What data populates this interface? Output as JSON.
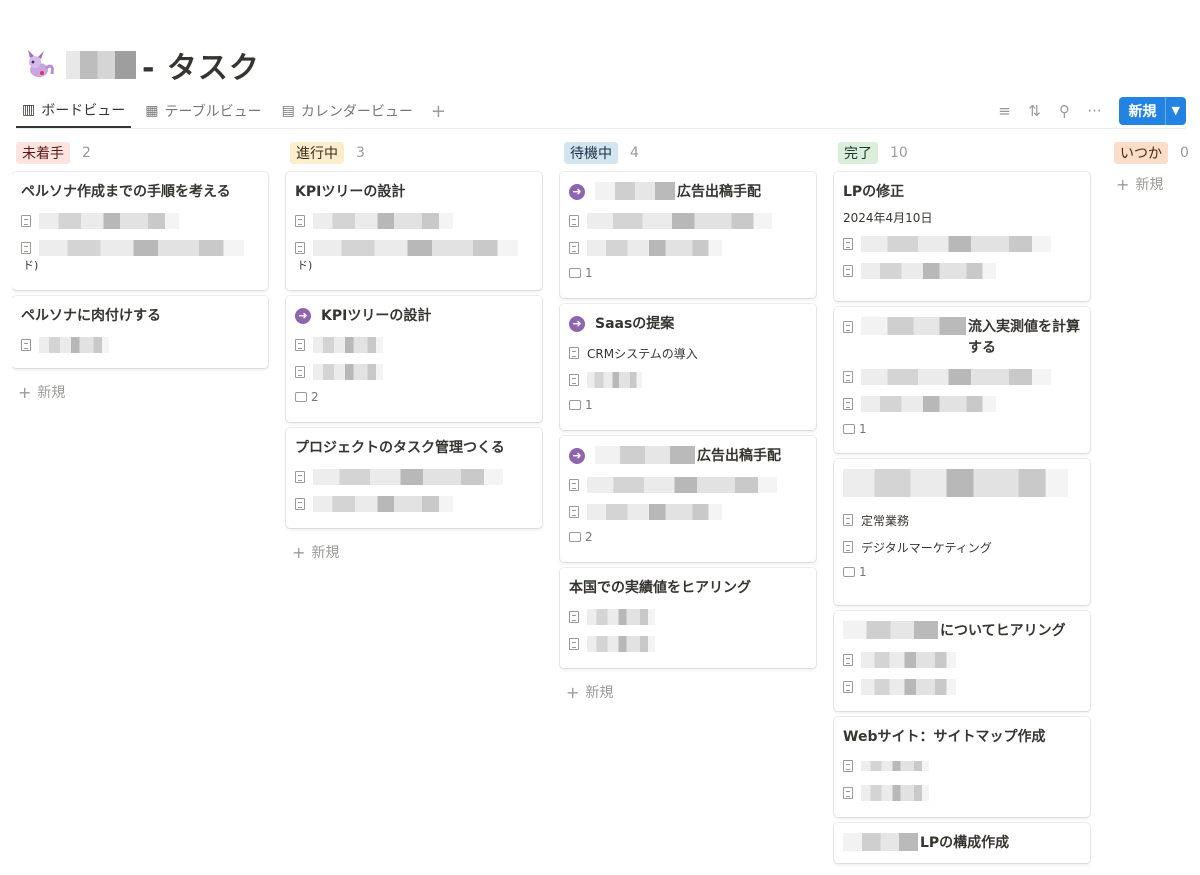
{
  "page": {
    "title": "- タスク"
  },
  "tabs": [
    {
      "label": "ボードビュー",
      "icon": "board-icon"
    },
    {
      "label": "テーブルビュー",
      "icon": "table-icon"
    },
    {
      "label": "カレンダービュー",
      "icon": "calendar-icon"
    }
  ],
  "toolbar": {
    "new_label": "新規"
  },
  "colors": {
    "accent": "#2383e2",
    "arrow": "#9065b0"
  },
  "columns": [
    {
      "status": "未着手",
      "count": "2",
      "bg": "#fde4e1",
      "fg": "#5d1715",
      "add_label": "新規"
    },
    {
      "status": "進行中",
      "count": "3",
      "bg": "#fbeecc",
      "fg": "#402c1b",
      "add_label": "新規"
    },
    {
      "status": "待機中",
      "count": "4",
      "bg": "#d3e5ef",
      "fg": "#183347",
      "add_label": "新規"
    },
    {
      "status": "完了",
      "count": "10",
      "bg": "#dbeddb",
      "fg": "#1c3829"
    },
    {
      "status": "いつか",
      "count": "0",
      "bg": "#fadec9",
      "fg": "#49290e",
      "add_label": "新規"
    }
  ],
  "cards": {
    "c0_0": {
      "title": "ペルソナ作成までの手順を考える",
      "wrap": "ド)"
    },
    "c0_1": {
      "title": "ペルソナに肉付けする"
    },
    "c1_0": {
      "title": "KPIツリーの設計",
      "wrap": "ド)"
    },
    "c1_1": {
      "title": "KPIツリーの設計",
      "comments": "2"
    },
    "c1_2": {
      "title": "プロジェクトのタスク管理つくる"
    },
    "c2_0": {
      "title": "広告出稿手配",
      "comments": "1"
    },
    "c2_1": {
      "title": "Saasの提案",
      "prop": "CRMシステムの導入",
      "comments": "1"
    },
    "c2_2": {
      "title": "広告出稿手配",
      "comments": "2"
    },
    "c2_3": {
      "title": "本国での実績値をヒアリング"
    },
    "c3_0": {
      "title": "LPの修正",
      "date": "2024年4月10日"
    },
    "c3_1": {
      "title": "流入実測値を計算する",
      "comments": "1"
    },
    "c3_2": {
      "prop1": "定常業務",
      "prop2": "デジタルマーケティング",
      "comments": "1"
    },
    "c3_3": {
      "title": "についてヒアリング"
    },
    "c3_4": {
      "title": "Webサイト：サイトマップ作成"
    },
    "c3_5": {
      "title": "LPの構成作成"
    }
  }
}
